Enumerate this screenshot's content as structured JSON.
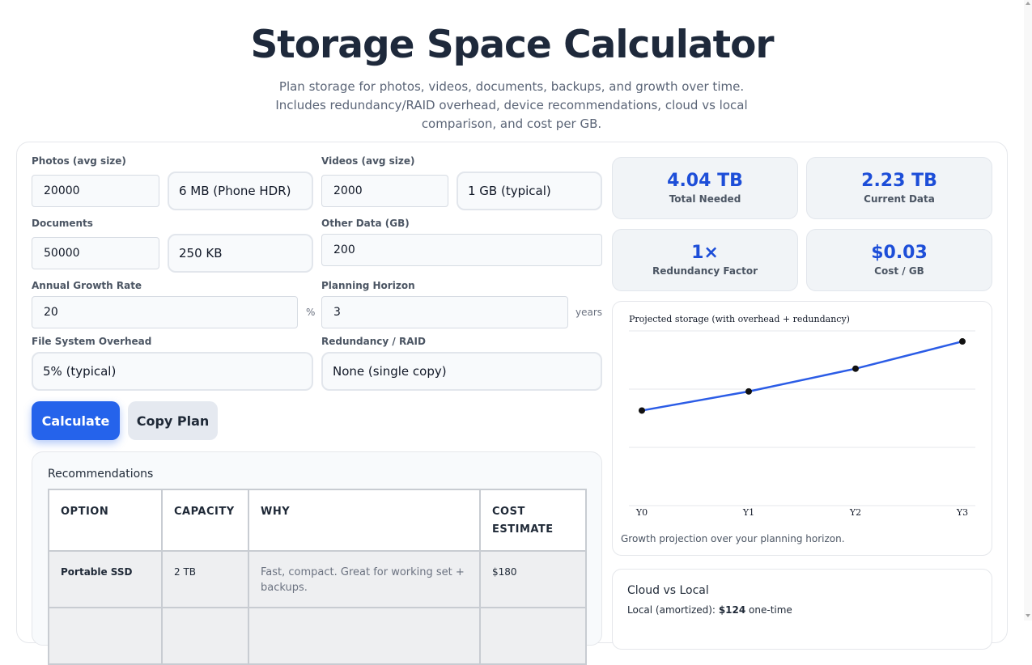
{
  "header": {
    "title": "Storage Space Calculator",
    "subtitle": "Plan storage for photos, videos, documents, backups, and growth over time. Includes redundancy/RAID overhead, device recommendations, cloud vs local comparison, and cost per GB."
  },
  "form": {
    "photos": {
      "label": "Photos (avg size)",
      "count": "20000",
      "size": "6 MB (Phone HDR)"
    },
    "videos": {
      "label": "Videos (avg size)",
      "count": "2000",
      "size": "1 GB (typical)"
    },
    "documents": {
      "label": "Documents",
      "count": "50000",
      "size": "250 KB"
    },
    "other": {
      "label": "Other Data (GB)",
      "value": "200"
    },
    "growth": {
      "label": "Annual Growth Rate",
      "value": "20",
      "unit": "%"
    },
    "horizon": {
      "label": "Planning Horizon",
      "value": "3",
      "unit": "years"
    },
    "overhead": {
      "label": "File System Overhead",
      "value": "5% (typical)"
    },
    "redundancy": {
      "label": "Redundancy / RAID",
      "value": "None (single copy)"
    }
  },
  "buttons": {
    "calculate": "Calculate",
    "copy": "Copy Plan"
  },
  "stats": {
    "total": {
      "value": "4.04 TB",
      "label": "Total Needed"
    },
    "current": {
      "value": "2.23 TB",
      "label": "Current Data"
    },
    "redundancy": {
      "value": "1×",
      "label": "Redundancy Factor"
    },
    "cost": {
      "value": "$0.03",
      "label": "Cost / GB"
    }
  },
  "recommendations": {
    "title": "Recommendations",
    "headers": [
      "OPTION",
      "CAPACITY",
      "WHY",
      "COST ESTIMATE"
    ],
    "rows": [
      {
        "option": "Portable SSD",
        "capacity": "2 TB",
        "why": "Fast, compact. Great for working set + backups.",
        "cost": "$180"
      }
    ]
  },
  "chart": {
    "title": "Projected storage (with overhead + redundancy)",
    "caption": "Growth projection over your planning horizon."
  },
  "chart_data": {
    "type": "line",
    "title": "Projected storage (with overhead + redundancy)",
    "x": [
      "Y0",
      "Y1",
      "Y2",
      "Y3"
    ],
    "series": [
      {
        "values": [
          2.34,
          2.81,
          3.37,
          4.04
        ]
      }
    ],
    "ylim": [
      0,
      4.3
    ],
    "grid": true,
    "line_color": "#2b5ce6"
  },
  "cloud": {
    "title": "Cloud vs Local",
    "local_label": "Local (amortized):",
    "local_value": "$124",
    "local_suffix": "one-time"
  }
}
